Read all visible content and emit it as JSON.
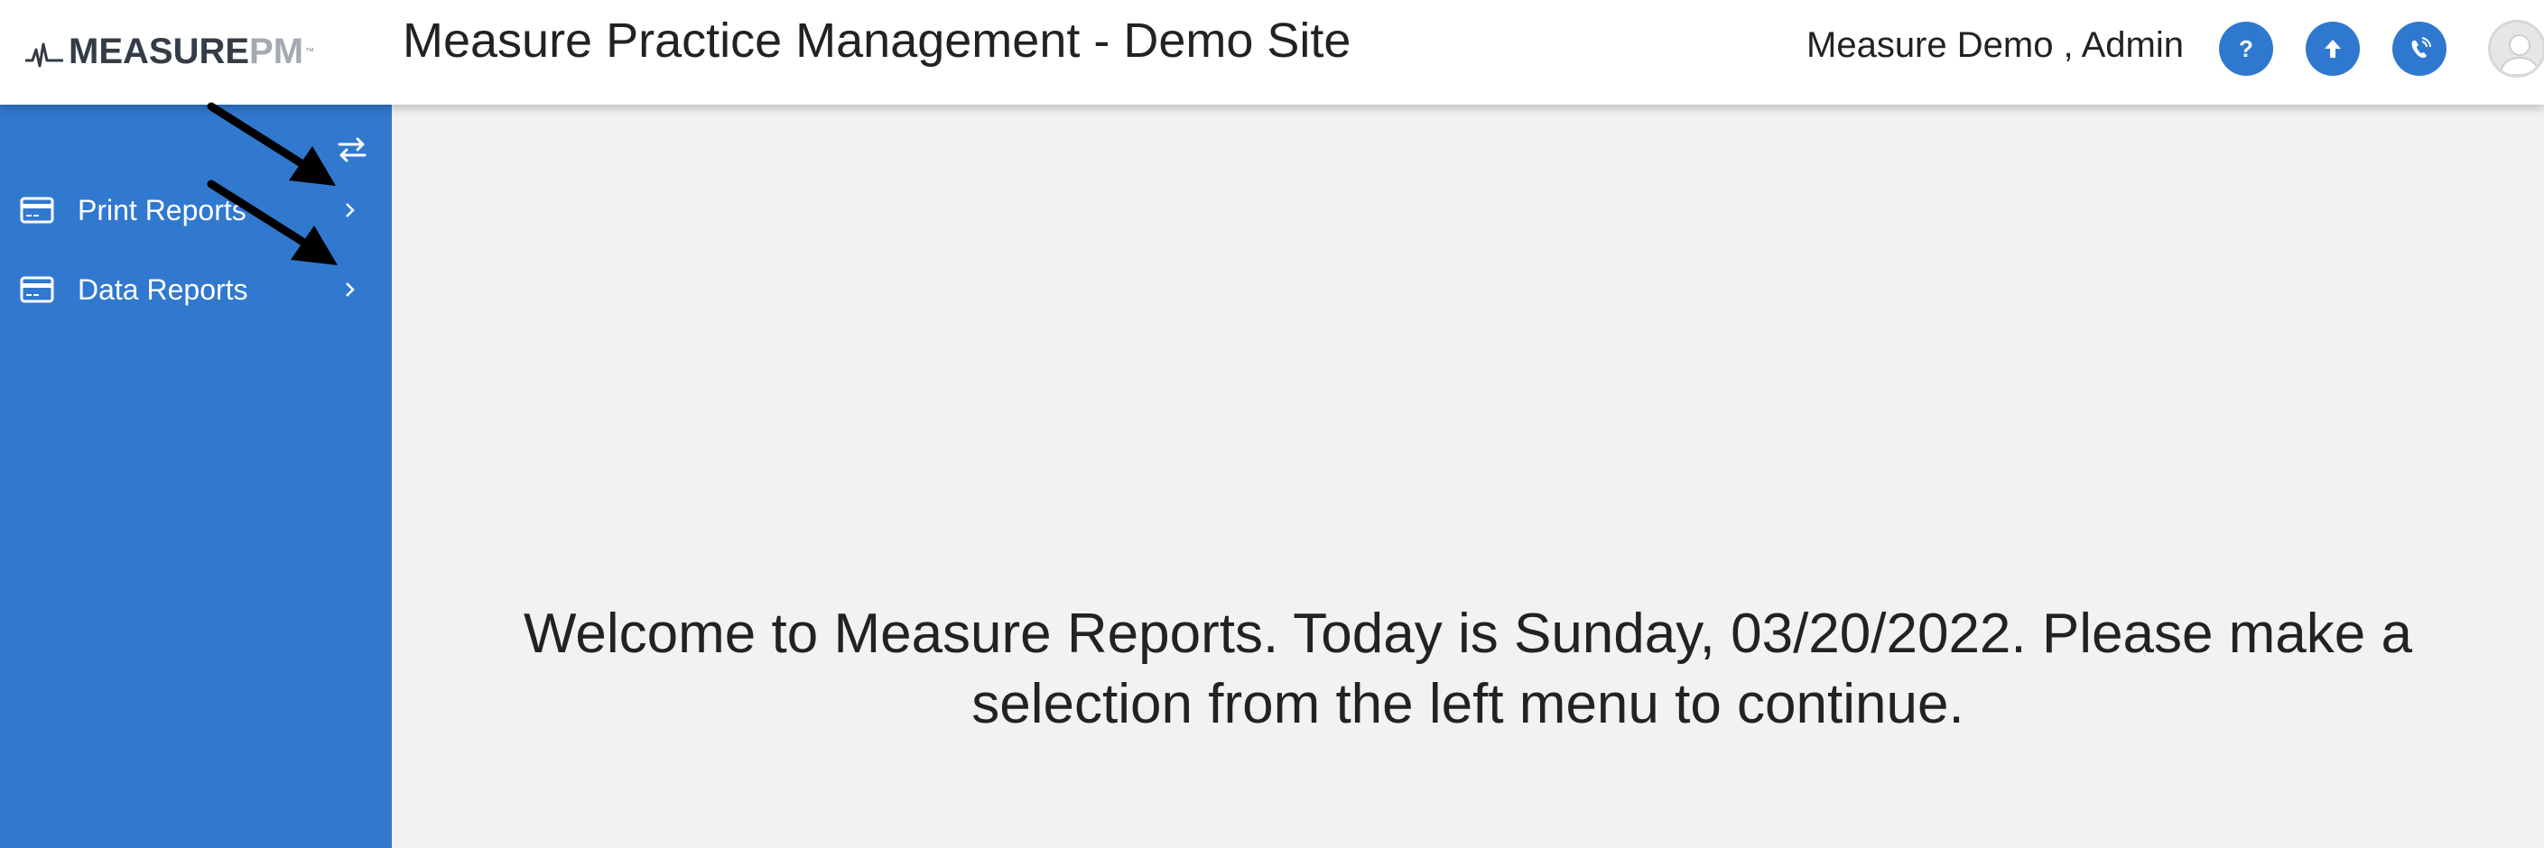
{
  "header": {
    "logo": {
      "text_main": "MEASURE",
      "text_accent": "PM",
      "tm": "™"
    },
    "title": "Measure Practice Management - Demo Site",
    "user_name": "Measure Demo , Admin",
    "buttons": [
      {
        "icon": "help-icon",
        "glyph": "?"
      },
      {
        "icon": "upload-arrow-icon"
      },
      {
        "icon": "phone-icon"
      }
    ],
    "avatar_icon": "user-avatar-icon"
  },
  "sidebar": {
    "toggle_icon": "swap-arrows-icon",
    "items": [
      {
        "label": "Print Reports",
        "icon": "credit-card-icon"
      },
      {
        "label": "Data Reports",
        "icon": "credit-card-icon"
      }
    ]
  },
  "main": {
    "welcome_text": "Welcome to Measure Reports. Today is Sunday, 03/20/2022. Please make a selection from the left menu to continue."
  },
  "colors": {
    "sidebar_bg": "#3178cf",
    "button_bg": "#2f78d0",
    "page_bg": "#f2f2f2",
    "annotation_arrow": "#000000"
  }
}
